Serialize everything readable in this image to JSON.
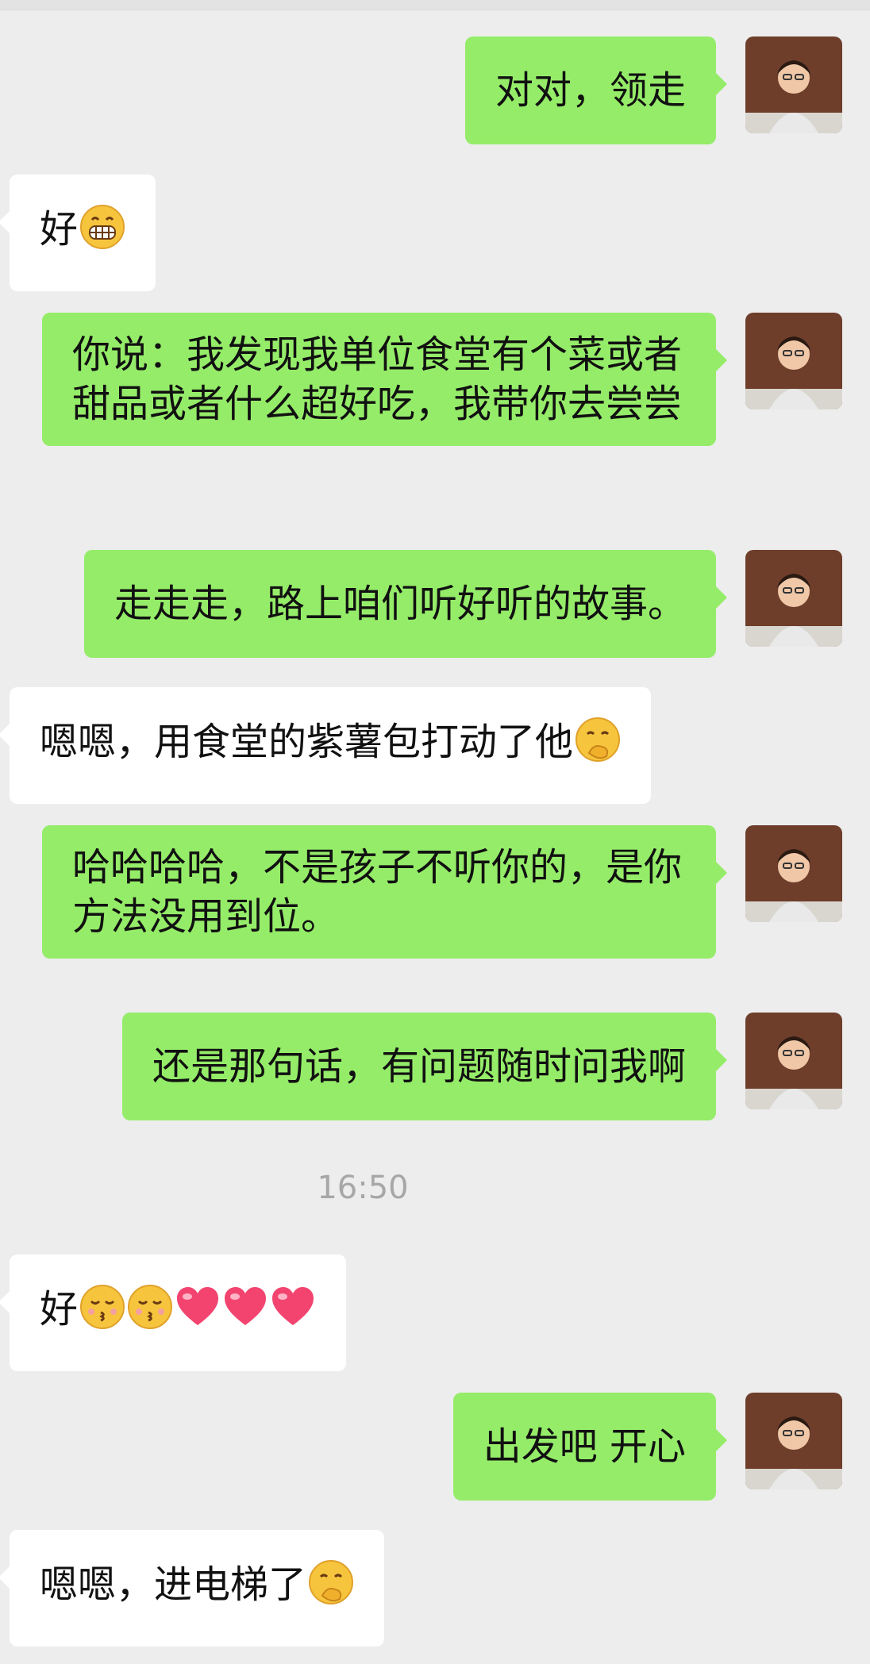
{
  "chat": {
    "messages": [
      {
        "side": "out",
        "text": "对对，领走"
      },
      {
        "side": "in",
        "text": "好",
        "emoji": [
          "grin-face"
        ]
      },
      {
        "side": "out",
        "text": "你说：我发现我单位食堂有个菜或者甜品或者什么超好吃，我带你去尝尝"
      },
      {
        "side": "out",
        "text": "走走走，路上咱们听好听的故事。"
      },
      {
        "side": "in",
        "text": "嗯嗯，用食堂的紫薯包打动了他",
        "emoji": [
          "shush-face"
        ]
      },
      {
        "side": "out",
        "text": "哈哈哈哈，不是孩子不听你的，是你方法没用到位。"
      },
      {
        "side": "out",
        "text": "还是那句话，有问题随时问我啊"
      },
      {
        "side": "in",
        "text": "好",
        "emoji": [
          "kiss-face",
          "kiss-face",
          "heart",
          "heart",
          "heart"
        ]
      },
      {
        "side": "out",
        "text": "出发吧 开心"
      },
      {
        "side": "in",
        "text": "嗯嗯，进电梯了",
        "emoji": [
          "shush-face"
        ]
      }
    ],
    "timestamp": "16:50"
  },
  "colors": {
    "background": "#ededed",
    "outgoing_bubble": "#95ec69",
    "incoming_bubble": "#ffffff",
    "timestamp_text": "#a7a7a7"
  }
}
